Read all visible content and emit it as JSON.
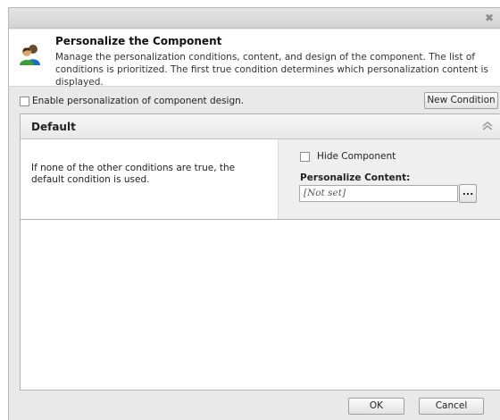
{
  "header": {
    "title": "Personalize the Component",
    "description": "Manage the personalization conditions, content, and design of the component. The list of conditions is prioritized. The first true condition determines which personalization content is displayed.",
    "icon": "people-icon"
  },
  "toolbar": {
    "enable_label": "Enable personalization of component design.",
    "enable_checked": false,
    "new_condition_label": "New Condition"
  },
  "panel": {
    "title": "Default",
    "condition_text": "If none of the other conditions are true, the default condition is used.",
    "hide_component_label": "Hide Component",
    "hide_component_checked": false,
    "personalize_content_label": "Personalize Content:",
    "personalize_content_value": "[Not set]",
    "browse_label": "..."
  },
  "footer": {
    "ok_label": "OK",
    "cancel_label": "Cancel"
  },
  "colors": {
    "dialog_bg": "#e9e9e9",
    "header_bg": "#ffffff",
    "panel_border": "#b3b3b3"
  }
}
